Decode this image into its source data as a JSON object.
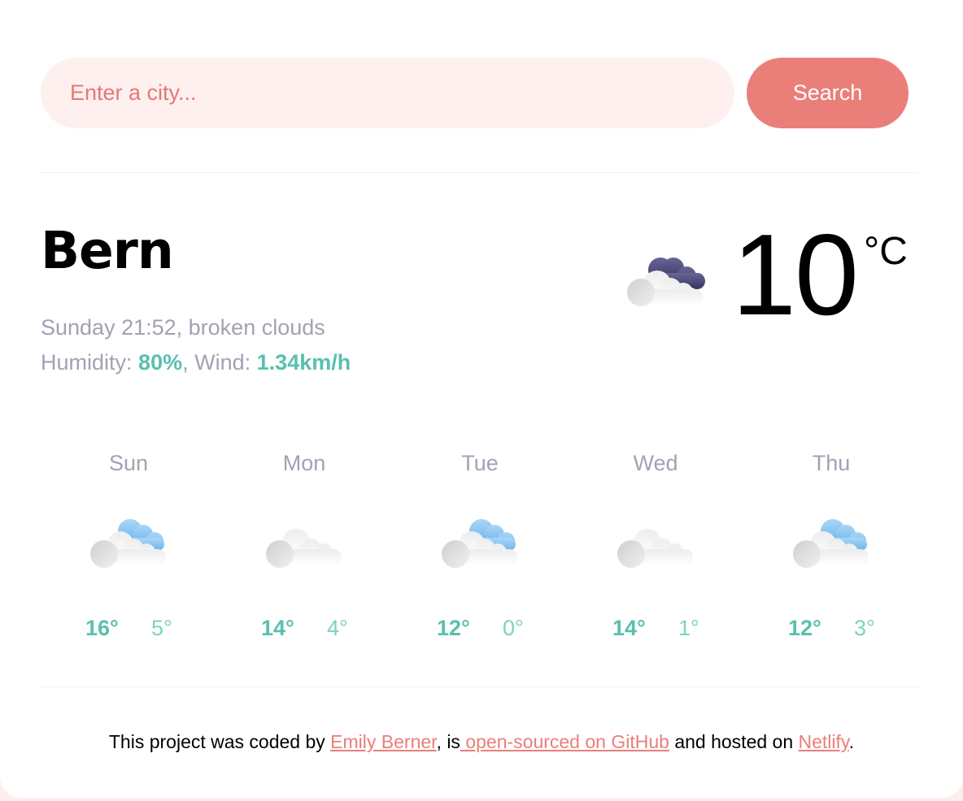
{
  "search": {
    "placeholder": "Enter a city...",
    "button_label": "Search"
  },
  "current": {
    "city": "Bern",
    "day_time": "Sunday 21:52",
    "description": "broken clouds",
    "humidity_label": "Humidity:",
    "humidity_value": "80%",
    "wind_label": "Wind:",
    "wind_value": "1.34km/h",
    "temperature": "10",
    "unit": "°C",
    "icon": "night-broken-clouds-icon"
  },
  "forecast": [
    {
      "day": "Sun",
      "max": "16°",
      "min": "5°",
      "icon": "scattered-clouds-icon"
    },
    {
      "day": "Mon",
      "max": "14°",
      "min": "4°",
      "icon": "clouds-icon"
    },
    {
      "day": "Tue",
      "max": "12°",
      "min": "0°",
      "icon": "scattered-clouds-icon"
    },
    {
      "day": "Wed",
      "max": "14°",
      "min": "1°",
      "icon": "clouds-icon"
    },
    {
      "day": "Thu",
      "max": "12°",
      "min": "3°",
      "icon": "scattered-clouds-icon"
    }
  ],
  "footer": {
    "text_1": "This project was coded by ",
    "link_author": "Emily Berner",
    "text_2": ", is",
    "link_github": " open-sourced on GitHub",
    "text_3": " and hosted on ",
    "link_netlify": "Netlify",
    "text_4": "."
  },
  "colors": {
    "accent": "#58c0b0",
    "brand": "#ea7f7a",
    "muted": "#a3a1b2",
    "input_bg": "#fdf0ef"
  }
}
